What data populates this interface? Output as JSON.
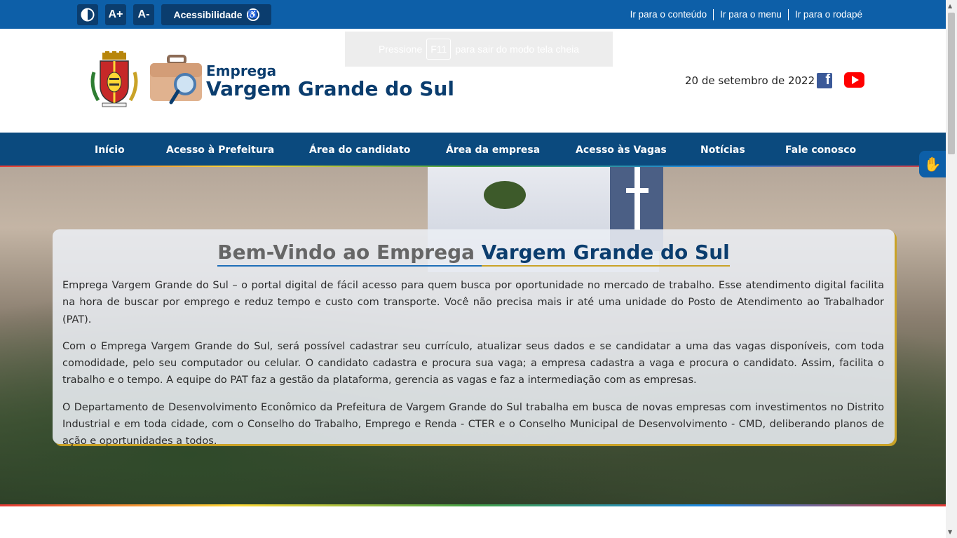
{
  "topbar": {
    "contrast_icon": "contrast-icon",
    "font_increase": "A+",
    "font_decrease": "A-",
    "accessibility_label": "Acessibilidade",
    "skip_links": [
      "Ir para o conteúdo",
      "Ir para o menu",
      "Ir para o rodapé"
    ]
  },
  "fullscreen_toast": {
    "before": "Pressione",
    "key": "F11",
    "after": "para sair do modo tela cheia"
  },
  "header": {
    "logo_small": "Emprega",
    "logo_big": "Vargem Grande do Sul",
    "date": "20 de setembro de 2022",
    "social": [
      "facebook-icon",
      "youtube-icon"
    ]
  },
  "nav": {
    "items": [
      "Início",
      "Acesso à Prefeitura",
      "Área do candidato",
      "Área da empresa",
      "Acesso às Vagas",
      "Notícias",
      "Fale conosco"
    ]
  },
  "welcome": {
    "title_part1": "Bem-Vindo ao Emprega ",
    "title_part2": "Vargem Grande do Sul",
    "paragraphs": [
      "Emprega Vargem Grande do Sul – o portal digital de fácil acesso para quem busca por oportunidade no mercado de trabalho. Esse atendimento digital facilita na hora de buscar por emprego e reduz tempo e custo com transporte. Você não precisa mais ir até uma unidade do Posto de Atendimento ao Trabalhador (PAT).",
      "Com o Emprega Vargem Grande do Sul, será possível cadastrar seu currículo, atualizar seus dados e se candidatar a uma das vagas disponíveis, com toda comodidade, pelo seu computador ou celular. O candidato cadastra e procura sua vaga; a empresa cadastra a vaga e procura o candidato. Assim, facilita o trabalho e o tempo. A equipe do PAT faz a gestão da plataforma, gerencia as vagas e faz a intermediação com as empresas.",
      "O Departamento de Desenvolvimento Econômico da Prefeitura de Vargem Grande do Sul trabalha em busca de novas empresas com investimentos no Distrito Industrial e em toda cidade, com o Conselho do Trabalho, Emprego e Renda - CTER e o Conselho Municipal de Desenvolvimento - CMD, deliberando planos de ação e oportunidades a todos."
    ]
  },
  "colors": {
    "topbar": "#0d5fa8",
    "nav": "#0b4a7e",
    "brand_dark": "#0b3d6e",
    "accent_gold": "#c9a227"
  }
}
